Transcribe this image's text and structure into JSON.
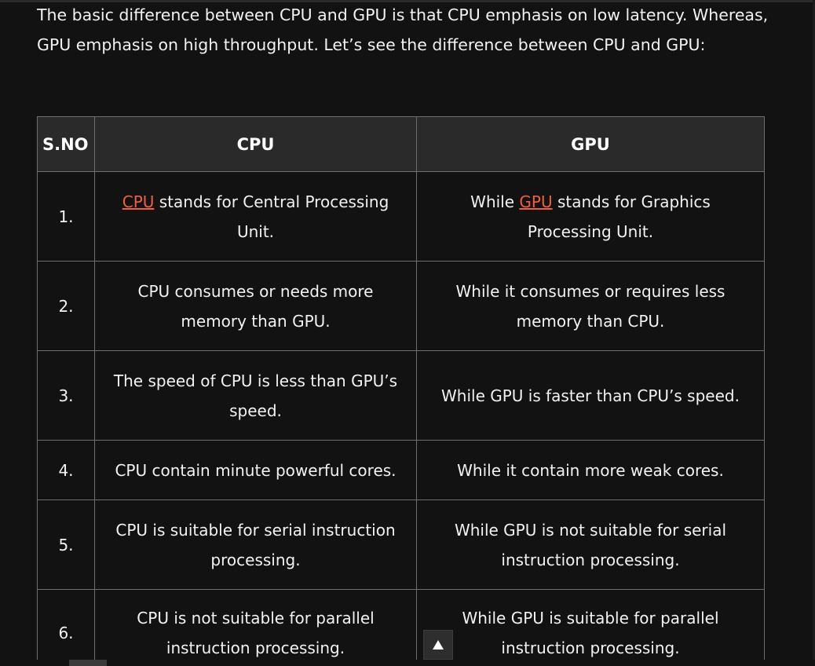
{
  "intro": {
    "text": "The basic difference between CPU and GPU is that CPU emphasis on low latency. Whereas, GPU emphasis on high throughput. Let’s see the difference between CPU and GPU:"
  },
  "table": {
    "headers": [
      "S.NO",
      "CPU",
      "GPU"
    ],
    "rows": [
      {
        "sno": "1.",
        "cpu_link": "CPU",
        "cpu_rest": " stands for Central Processing Unit.",
        "gpu_pre": "While ",
        "gpu_link": "GPU",
        "gpu_rest": " stands for Graphics Processing Unit."
      },
      {
        "sno": "2.",
        "cpu": "CPU consumes or needs more memory than GPU.",
        "gpu": "While it consumes or requires less memory than CPU."
      },
      {
        "sno": "3.",
        "cpu": "The speed of CPU is less than GPU’s speed.",
        "gpu": "While GPU is faster than CPU’s speed."
      },
      {
        "sno": "4.",
        "cpu": "CPU contain minute powerful cores.",
        "gpu": "While it contain more weak cores."
      },
      {
        "sno": "5.",
        "cpu": "CPU is suitable for serial instruction processing.",
        "gpu": "While GPU is not suitable for serial instruction processing."
      },
      {
        "sno": "6.",
        "cpu": "CPU is not suitable for parallel instruction processing.",
        "gpu": "While GPU is suitable for parallel instruction processing."
      }
    ]
  },
  "scroll_top": {
    "icon": "arrow-up-icon"
  },
  "colors": {
    "background": "#121212",
    "header_bg": "#2a2a2a",
    "link": "#f0603c",
    "border": "#6e6e6e"
  }
}
